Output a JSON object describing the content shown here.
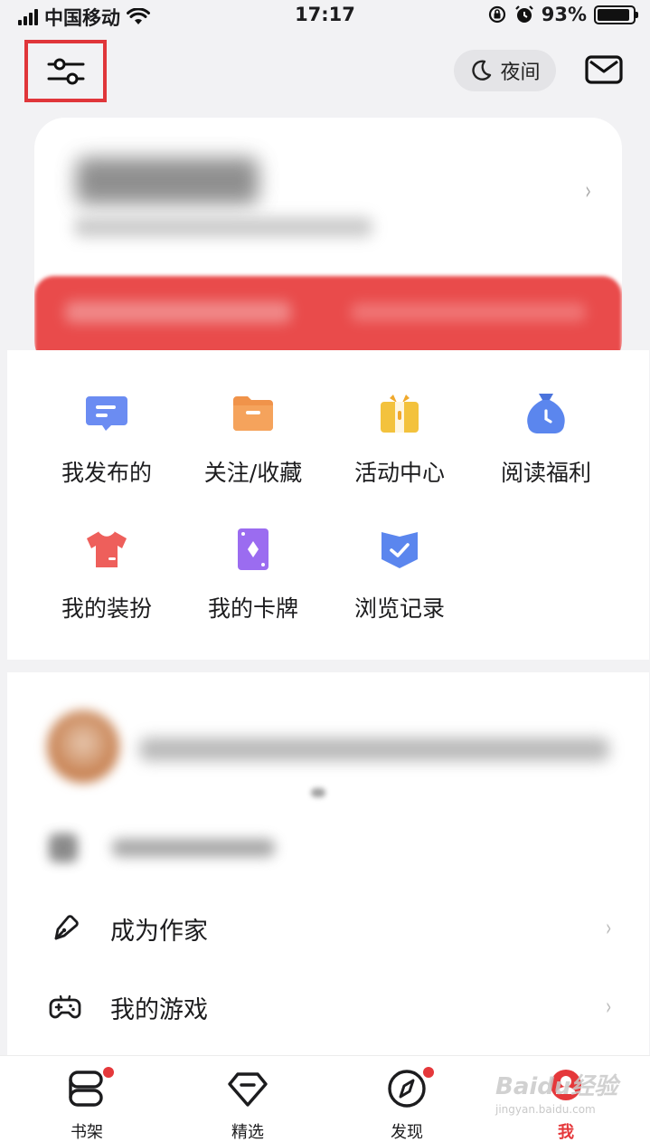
{
  "status_bar": {
    "carrier": "中国移动",
    "time": "17:17",
    "battery": "93%",
    "battery_level": 0.93
  },
  "header": {
    "settings_icon": "sliders-icon",
    "night_label": "夜间",
    "night_icon": "moon-icon",
    "mail_icon": "mail-icon"
  },
  "grid": {
    "items": [
      {
        "label": "我发布的",
        "icon": "message-icon",
        "color": "#6b8cf2"
      },
      {
        "label": "关注/收藏",
        "icon": "folder-icon",
        "color": "#f0934a"
      },
      {
        "label": "活动中心",
        "icon": "gift-icon",
        "color": "#f3c23d"
      },
      {
        "label": "阅读福利",
        "icon": "money-bag-clock-icon",
        "color": "#5b86ee"
      },
      {
        "label": "我的装扮",
        "icon": "tshirt-icon",
        "color": "#ee5f5b"
      },
      {
        "label": "我的卡牌",
        "icon": "card-icon",
        "color": "#9b6cf0"
      },
      {
        "label": "浏览记录",
        "icon": "shield-check-icon",
        "color": "#5b86ee"
      }
    ]
  },
  "list": {
    "items": [
      {
        "label": "成为作家",
        "icon": "pen-icon"
      },
      {
        "label": "我的游戏",
        "icon": "gamepad-icon"
      }
    ]
  },
  "tabbar": {
    "items": [
      {
        "label": "书架",
        "icon": "bookshelf-icon",
        "badge": true,
        "active": false
      },
      {
        "label": "精选",
        "icon": "diamond-icon",
        "badge": false,
        "active": false
      },
      {
        "label": "发现",
        "icon": "compass-icon",
        "badge": true,
        "active": false
      },
      {
        "label": "我",
        "icon": "profile-icon",
        "badge": false,
        "active": true
      }
    ],
    "active_color": "#e5383b"
  },
  "watermark": {
    "text": "Baidu经验",
    "sub": "jingyan.baidu.com"
  }
}
